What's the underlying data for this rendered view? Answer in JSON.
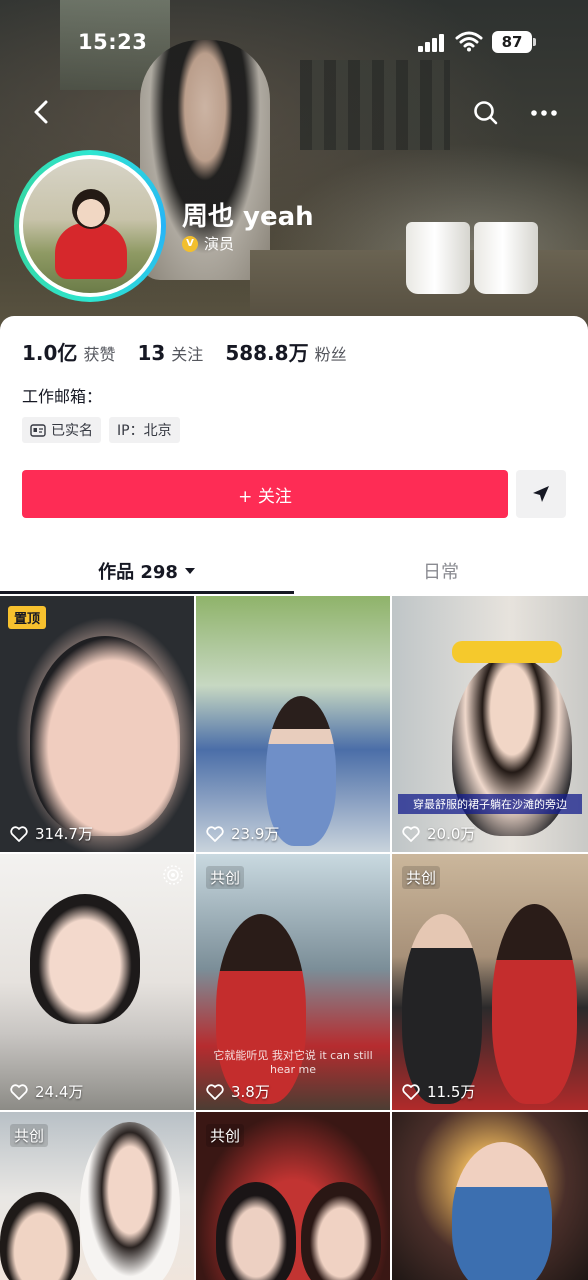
{
  "status_bar": {
    "time": "15:23",
    "battery": "87"
  },
  "header": {
    "back_icon": "chevron-left-icon",
    "search_icon": "search-icon",
    "more_icon": "more-horizontal-icon"
  },
  "profile": {
    "name": "周也 yeah",
    "verification_label": "演员",
    "verification_color": "#f2bf2e"
  },
  "stats": [
    {
      "value": "1.0亿",
      "label": "获赞"
    },
    {
      "value": "13",
      "label": "关注"
    },
    {
      "value": "588.8万",
      "label": "粉丝"
    }
  ],
  "email_label": "工作邮箱：",
  "tags": [
    {
      "icon": "id-card-icon",
      "label": "已实名"
    },
    {
      "label": "IP：北京"
    }
  ],
  "follow_button": {
    "label": "+ 关注",
    "color": "#fe2c55"
  },
  "share_button": {
    "icon": "send-icon"
  },
  "tabs": {
    "works_label": "作品 298",
    "daily_label": "日常"
  },
  "videos": [
    {
      "likes": "314.7万",
      "badge": "置顶"
    },
    {
      "likes": "23.9万"
    },
    {
      "likes": "20.0万",
      "caption": "穿最舒服的裙子躺在沙滩的旁边"
    },
    {
      "likes": "24.4万"
    },
    {
      "likes": "3.8万",
      "badge": "共创",
      "caption": "它就能听见 我对它说 it can still hear me"
    },
    {
      "likes": "11.5万",
      "badge": "共创"
    },
    {
      "badge": "共创"
    },
    {
      "badge": "共创"
    },
    {}
  ]
}
